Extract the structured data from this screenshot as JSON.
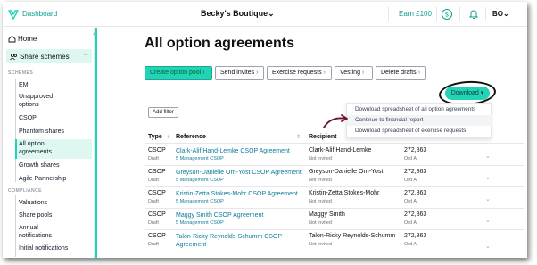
{
  "topbar": {
    "dashboard_label": "Dashboard",
    "company_label": "Becky's Boutique",
    "company_chevron": "⌄",
    "earn_label": "Earn £100",
    "user_initials": "BO",
    "user_chevron": "⌄",
    "icons": [
      "logo-icon",
      "help-icon",
      "bell-icon"
    ]
  },
  "sidebar": {
    "collapse_glyph": "‹",
    "home_label": "Home",
    "share_schemes_label": "Share schemes",
    "share_schemes_chevron": "⌃",
    "schemes_section": "SCHEMES",
    "schemes_items": [
      "EMI",
      "Unapproved options",
      "CSOP",
      "Phantom shares",
      "All option agreements",
      "Growth shares",
      "Agile Partnership"
    ],
    "compliance_section": "COMPLIANCE",
    "compliance_items": [
      "Valuations",
      "Share pools",
      "Annual notifications",
      "Initial notifications"
    ]
  },
  "main": {
    "title": "All option agreements",
    "actions": [
      "Create option pool",
      "Send invites",
      "Exercise requests",
      "Vesting",
      "Delete drafts"
    ],
    "download_label": "Download",
    "download_caret": "▾",
    "filter_label": "Add filter",
    "menu_items": [
      "Download spreadsheet of all option agreements",
      "Continue to financial report",
      "Download spreadsheet of exercise requests"
    ],
    "columns": {
      "type": "Type",
      "type_sort": "↑",
      "reference": "Reference",
      "reference_sort": "⇕",
      "recipient": "Recipient"
    },
    "rows": [
      {
        "type": "CSOP",
        "status": "Draft",
        "reference": "Clark-Alif Hand-Lemke CSOP Agreement",
        "scheme": "5 Management CSOP",
        "recipient": "Clark-Alif Hand-Lemke",
        "invite": "Not invited",
        "shares": "272,863",
        "class": "Ord A"
      },
      {
        "type": "CSOP",
        "status": "Draft",
        "reference": "Greyson-Danielle Orn-Yost CSOP Agreement",
        "scheme": "5 Management CSOP",
        "recipient": "Greyson-Danielle Orn-Yost",
        "invite": "Not invited",
        "shares": "272,863",
        "class": "Ord A"
      },
      {
        "type": "CSOP",
        "status": "Draft",
        "reference": "Kristin-Zetta Stokes-Mohr CSOP Agreement",
        "scheme": "5 Management CSOP",
        "recipient": "Kristin-Zetta Stokes-Mohr",
        "invite": "Not invited",
        "shares": "272,863",
        "class": "Ord A"
      },
      {
        "type": "CSOP",
        "status": "Draft",
        "reference": "Maggy Smith CSOP Agreement",
        "scheme": "5 Management CSOP",
        "recipient": "Maggy Smith",
        "invite": "Not invited",
        "shares": "272,863",
        "class": "Ord A"
      },
      {
        "type": "CSOP",
        "status": "Draft",
        "reference": "Talon-Ricky Reynolds-Schumm CSOP Agreement",
        "scheme": "",
        "recipient": "Talon-Ricky Reynolds-Schumm",
        "invite": "Not invited",
        "shares": "272,863",
        "class": "Ord A"
      }
    ],
    "row_chevron": "⌄"
  },
  "colors": {
    "accent": "#22d3b6",
    "accent_light": "#dff7f1",
    "link": "#0e7c9a"
  }
}
